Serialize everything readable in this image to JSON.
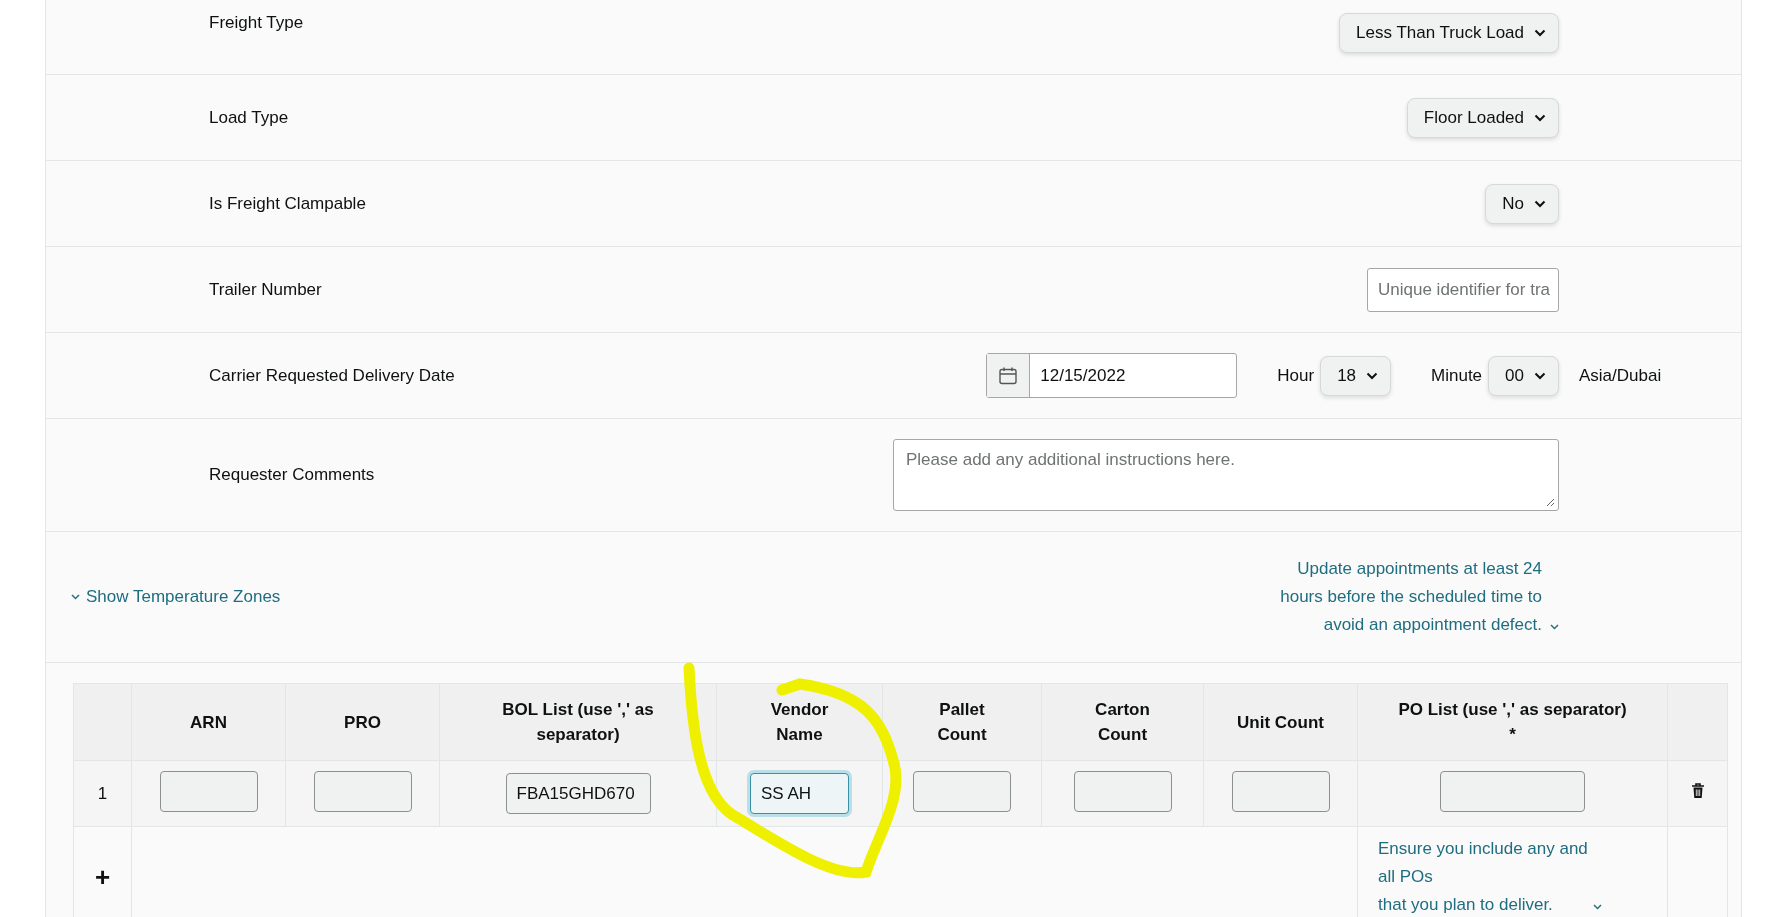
{
  "form_rows": [
    {
      "kind": "select",
      "label": "Freight Type",
      "value": "Less Than Truck Load"
    },
    {
      "kind": "select",
      "label": "Load Type",
      "value": "Floor Loaded"
    },
    {
      "kind": "select",
      "label": "Is Freight Clampable",
      "value": "No"
    },
    {
      "kind": "text",
      "label": "Trailer Number",
      "placeholder": "Unique identifier for tra"
    },
    {
      "kind": "datetime",
      "label": "Carrier Requested Delivery Date",
      "date": "12/15/2022",
      "hour_label": "Hour",
      "hour": "18",
      "minute_label": "Minute",
      "minute": "00",
      "timezone": "Asia/Dubai"
    },
    {
      "kind": "textarea",
      "label": "Requester Comments",
      "placeholder": "Please add any additional instructions here."
    }
  ],
  "temperature_toggle": {
    "label": "Show Temperature Zones",
    "expanded": false
  },
  "notice": {
    "text": "Update appointments at least 24 hours before the scheduled time to avoid an appointment defect.",
    "expanded": false
  },
  "table": {
    "columns": [
      {},
      {
        "label": "ARN"
      },
      {
        "label": "PRO"
      },
      {
        "label": "BOL List (use ',' as separator)"
      },
      {
        "label": "Vendor Name"
      },
      {
        "label": "Pallet Count"
      },
      {
        "label": "Carton Count"
      },
      {
        "label": "Unit Count"
      },
      {
        "label": "PO List (use ',' as separator)",
        "required_mark": "*"
      },
      {}
    ],
    "rows": [
      {
        "cells": [
          {
            "kind": "number",
            "value": "1"
          },
          {
            "kind": "input",
            "focused": false
          },
          {
            "kind": "input",
            "focused": false
          },
          {
            "kind": "input",
            "value": "FBA15GHD670",
            "focused": false
          },
          {
            "kind": "input",
            "value": "SS AH",
            "focused": true
          },
          {
            "kind": "input",
            "focused": false
          },
          {
            "kind": "input",
            "focused": false
          },
          {
            "kind": "input",
            "focused": false
          },
          {
            "kind": "input",
            "focused": false
          },
          {
            "kind": "delete"
          }
        ]
      }
    ],
    "add_row": "+",
    "po_note": {
      "text": "Ensure you include any and all POs\nthat you plan to deliver.",
      "expanded": false
    }
  }
}
